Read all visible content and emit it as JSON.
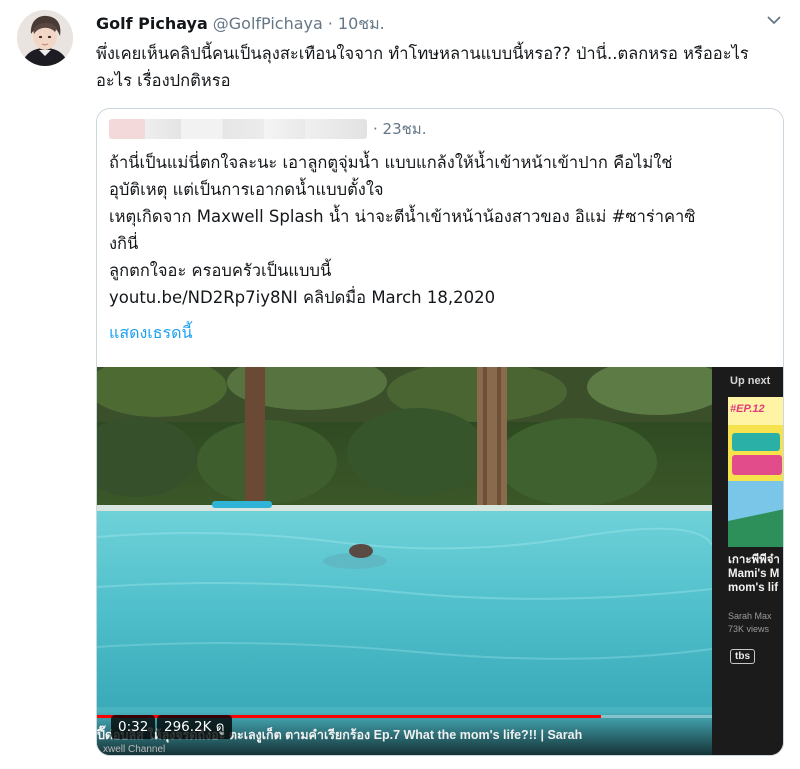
{
  "tweet": {
    "display_name": "Golf Pichaya",
    "handle": "@GolfPichaya",
    "separator": "·",
    "time": "10ชม.",
    "text": "พึ่งเคยเห็นคลิปนี้คนเป็นลุงสะเทือนใจจาก ทำโทษหลานแบบนี้หรอ?? ป่านี่..ตลกหรอ หรืออะไร อะไร เรื่องปกติหรอ"
  },
  "quoted_tweet": {
    "time": "· 23ชม.",
    "lines": [
      "ถ้านี่เป็นแม่นี่ตกใจละนะ เอาลูกตูจุ่มน้ำ แบบแกล้งให้น้ำเข้าหน้าเข้าปาก คือไม่ใช่",
      "อุบัติเหตุ แต่เป็นการเอากดน้ำแบบตั้งใจ",
      "เหตุเกิดจาก Maxwell Splash น้ำ น่าจะตีน้ำเข้าหน้าน้องสาวของ อิแม่ #ซาร่าคาซิ",
      "งกินี่",
      "ลูกตกใจอะ ครอบครัวเป็นแบบนี้",
      "youtu.be/ND2Rp7iy8NI  คลิปดมื่อ March 18,2020"
    ],
    "show_thread": "แสดงเธรดนี้"
  },
  "video": {
    "elapsed": "0:32",
    "views": "296.2K ดู",
    "progress": 0.82,
    "title": "ปี๊ด่อบลีส ให้ลุงจรดถึงอะ ตะเลงูเก็ต ตามคำเรียกร้อง Ep.7 What the mom's life?!! | Sarah",
    "channel_fragment": "xwell Channel",
    "up_next": {
      "label": "Up next",
      "episode": "#EP.12",
      "title_lines": [
        "เกาะพีพีจ๋า",
        "Mami's M",
        "mom's lif"
      ],
      "channel": "Sarah Max",
      "views": "73K views",
      "network_logo": "tbs"
    }
  },
  "colors": {
    "link": "#1da1f2",
    "secondary_text": "#657786",
    "border": "#ccd6dd",
    "progress": "#ff0000"
  },
  "icons": {
    "caret": "chevron-down-icon"
  }
}
